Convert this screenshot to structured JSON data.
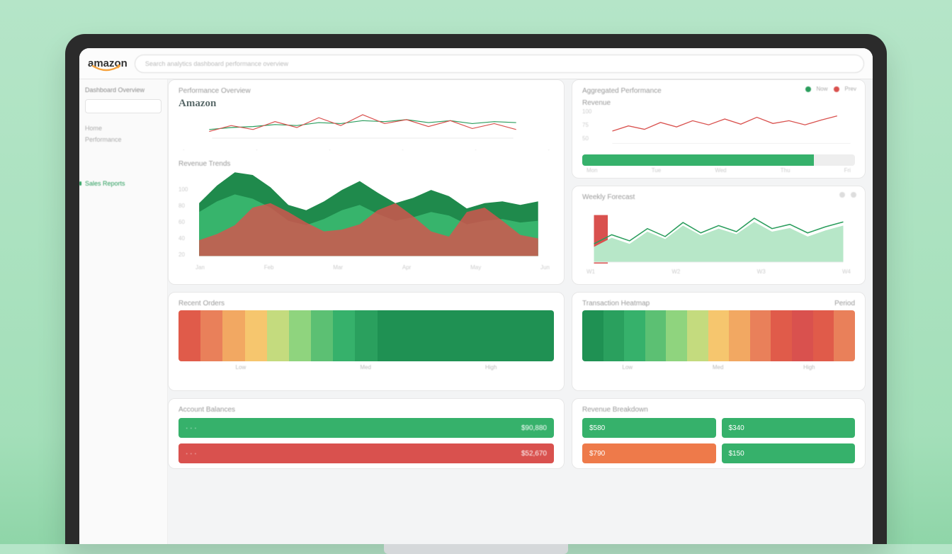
{
  "header": {
    "logo_text": "amazon",
    "search_placeholder": "Search analytics dashboard performance overview"
  },
  "sidebar": {
    "section_title": "Dashboard Overview",
    "items": [
      "Home",
      "Performance",
      "Sales Reports"
    ]
  },
  "cards": {
    "bigleft_title": "Performance Overview",
    "bigleft_heading": "Amazon",
    "bigleft_sub": "Revenue Trends",
    "right_top_title": "Aggregated Performance",
    "right_top_sub": "Revenue",
    "right_top_badge_1": "Now",
    "right_top_badge_2": "Prev",
    "right_bottom_title": "Weekly Forecast",
    "heat_left_title": "Recent Orders",
    "heat_right_title": "Transaction Heatmap",
    "heat_right_sub": "Period",
    "heat_labels": [
      "Low",
      "Med",
      "High"
    ],
    "footer_left_title": "Account Balances",
    "footer_left_val1": "$90,880",
    "footer_left_val2": "$52,670",
    "footer_right_title": "Revenue Breakdown",
    "footer_right_v1": "$580",
    "footer_right_v2": "$340",
    "footer_right_v3": "$790",
    "footer_right_v4": "$150"
  },
  "chart_data": [
    {
      "type": "line",
      "title": "Performance Overview (top lines)",
      "x": [
        0,
        1,
        2,
        3,
        4,
        5,
        6,
        7,
        8,
        9,
        10,
        11,
        12,
        13,
        14
      ],
      "series": [
        {
          "name": "green",
          "color": "#2a9d5c",
          "values": [
            40,
            42,
            43,
            45,
            44,
            47,
            46,
            49,
            48,
            50,
            47,
            49,
            46,
            48,
            47
          ]
        },
        {
          "name": "red",
          "color": "#d9514e",
          "values": [
            38,
            44,
            40,
            48,
            42,
            52,
            44,
            55,
            46,
            50,
            43,
            49,
            41,
            46,
            40
          ]
        }
      ],
      "ylim": [
        30,
        60
      ]
    },
    {
      "type": "area",
      "title": "Revenue Trends (stacked area)",
      "x": [
        0,
        1,
        2,
        3,
        4,
        5,
        6,
        7,
        8,
        9,
        10,
        11,
        12,
        13,
        14,
        15,
        16,
        17,
        18,
        19
      ],
      "ylim": [
        0,
        100
      ],
      "y_ticks": [
        "100",
        "80",
        "60",
        "40",
        "20"
      ],
      "x_ticks": [
        "Jan",
        "Feb",
        "Mar",
        "Apr",
        "May",
        "Jun"
      ],
      "series": [
        {
          "name": "dark-green",
          "color": "#1f8a4c",
          "values": [
            60,
            80,
            95,
            92,
            78,
            58,
            52,
            62,
            75,
            85,
            72,
            60,
            66,
            75,
            68,
            54,
            60,
            62,
            58,
            62
          ]
        },
        {
          "name": "mid-green",
          "color": "#3cbb72",
          "values": [
            50,
            62,
            70,
            65,
            55,
            40,
            35,
            42,
            52,
            58,
            48,
            40,
            44,
            50,
            46,
            36,
            40,
            42,
            38,
            40
          ]
        },
        {
          "name": "red",
          "color": "#d9514e",
          "values": [
            18,
            25,
            35,
            55,
            60,
            50,
            38,
            28,
            30,
            36,
            52,
            60,
            45,
            28,
            22,
            50,
            55,
            40,
            24,
            20
          ]
        }
      ]
    },
    {
      "type": "line",
      "title": "Aggregated Performance",
      "x": [
        0,
        1,
        2,
        3,
        4,
        5,
        6,
        7,
        8,
        9,
        10,
        11,
        12,
        13,
        14
      ],
      "ylim": [
        0,
        100
      ],
      "y_ticks": [
        "100",
        "75",
        "50"
      ],
      "progress_pct": 85,
      "x_ticks": [
        "Mon",
        "Tue",
        "Wed",
        "Thu",
        "Fri"
      ],
      "series": [
        {
          "name": "red",
          "color": "#d9514e",
          "values": [
            30,
            45,
            35,
            55,
            42,
            60,
            48,
            65,
            50,
            70,
            52,
            60,
            48,
            62,
            74
          ]
        }
      ]
    },
    {
      "type": "area",
      "title": "Weekly Forecast",
      "x": [
        0,
        1,
        2,
        3,
        4,
        5,
        6,
        7,
        8,
        9,
        10,
        11,
        12,
        13,
        14
      ],
      "ylim": [
        0,
        100
      ],
      "x_ticks": [
        "W1",
        "W2",
        "W3",
        "W4"
      ],
      "series": [
        {
          "name": "green-line",
          "color": "#2a9d5c",
          "values": [
            30,
            45,
            35,
            55,
            42,
            65,
            48,
            60,
            50,
            72,
            55,
            62,
            48,
            58,
            66
          ]
        },
        {
          "name": "light-green-area",
          "color": "#b7e7c8",
          "values": [
            25,
            40,
            30,
            50,
            38,
            60,
            44,
            55,
            46,
            66,
            50,
            56,
            42,
            52,
            60
          ]
        },
        {
          "name": "red-left",
          "color": "#d9514e",
          "values": [
            60,
            58,
            0,
            0,
            0,
            0,
            0,
            0,
            0,
            0,
            0,
            0,
            0,
            0,
            0
          ]
        }
      ]
    },
    {
      "type": "heatmap",
      "title": "Recent Orders heatmap",
      "colors": [
        "#e05b4a",
        "#e9805a",
        "#f2a862",
        "#f6c66e",
        "#c4db7e",
        "#8fd47e",
        "#5cc073",
        "#36b16b",
        "#2aa05e",
        "#1f9153",
        "#1f9153",
        "#1f9153",
        "#1f9153",
        "#1f9153",
        "#1f9153",
        "#1f9153",
        "#1f9153"
      ]
    },
    {
      "type": "heatmap",
      "title": "Transaction Heatmap",
      "colors": [
        "#1f9153",
        "#2aa05e",
        "#36b16b",
        "#5cc073",
        "#8fd47e",
        "#c4db7e",
        "#f6c66e",
        "#f2a862",
        "#e9805a",
        "#e05b4a",
        "#d9514e",
        "#e05b4a",
        "#e9805a"
      ]
    }
  ]
}
